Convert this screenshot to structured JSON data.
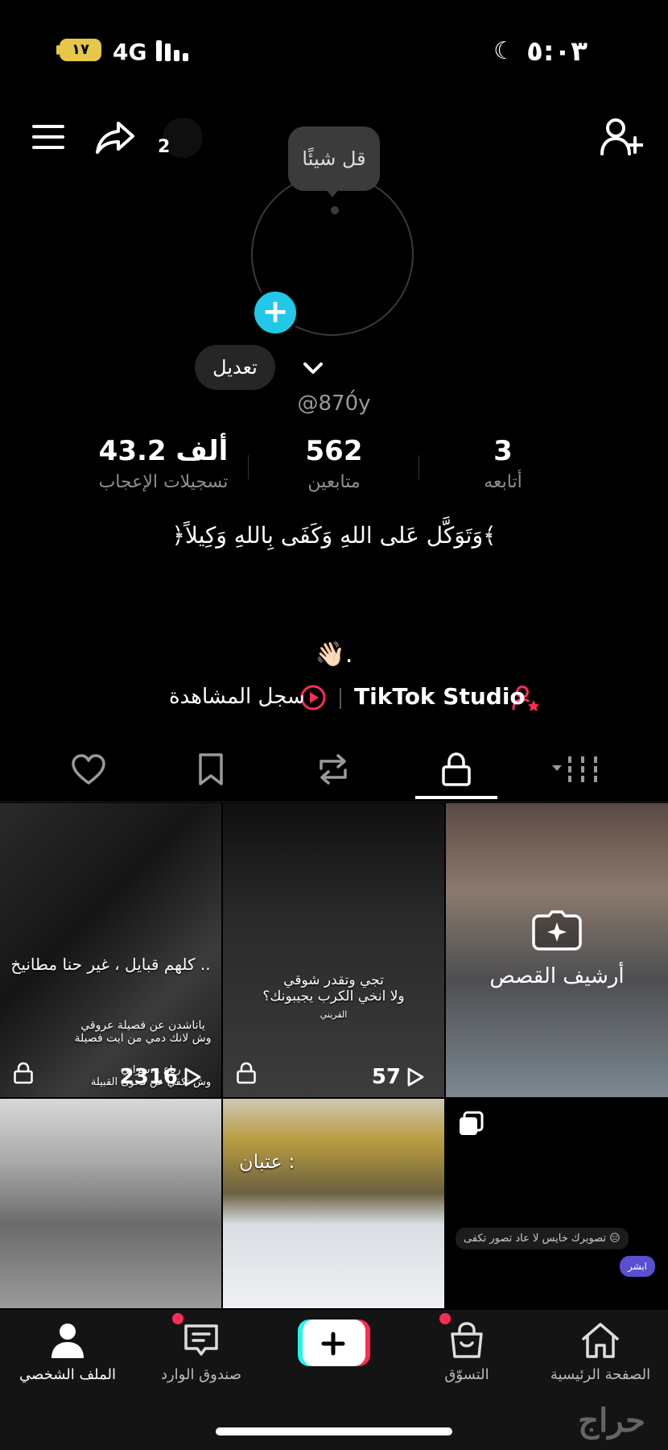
{
  "status_bar": {
    "battery": "١٧",
    "network": "4G",
    "time": "٥:٠٣"
  },
  "top_bar": {
    "share_count": "2"
  },
  "profile": {
    "bubble_text": "قل شيئًا",
    "edit_label": "تعديل",
    "username": "@870́y",
    "stats": [
      {
        "value": "3",
        "label": "أتابعه"
      },
      {
        "value": "562",
        "label": "متابعين"
      },
      {
        "value": "43.2 ألف",
        "label": "تسجيلات الإعجاب"
      }
    ],
    "bio": "﴿وَتَوَكَّل عَلى اللهِ وَكَفَى بِاللهِ وَكِيلاً﴾",
    "wave": "👋🏻.",
    "studio_label": "TikTok Studio",
    "watch_history_label": "سجل المشاهدة"
  },
  "tabs": {
    "active": "private"
  },
  "grid": [
    {
      "caption_main": "كلهم قبايل ، غير حنا مطانيخ ..",
      "caption_sub": "ياناشدن عن فصيلة عروقي\nوش لانك دمي من ايت فصيلة",
      "caption_sub2": "رباع ...سراني\nوش تكفي عن فحوى القبيلة",
      "count": "2316",
      "locked": true
    },
    {
      "caption_main": "تجي وتقدر شوقي\nولا انخي الكرب يجيبونك؟",
      "caption_sub": "القريني",
      "count": "57",
      "locked": true
    },
    {
      "story_label": "أرشيف القصص"
    },
    {},
    {
      "caption_main": "عتبان :"
    },
    {
      "chat_1": "تصويرك خايس لا عاد تصور تكفى 😑",
      "chat_2": "ابشر"
    }
  ],
  "bottom_nav": {
    "items": [
      {
        "label": "الصفحة الرئيسية"
      },
      {
        "label": "التسوّق"
      },
      {
        "label": "صندوق الوارد"
      },
      {
        "label": "الملف الشخصي"
      }
    ]
  },
  "watermark": "حراج"
}
